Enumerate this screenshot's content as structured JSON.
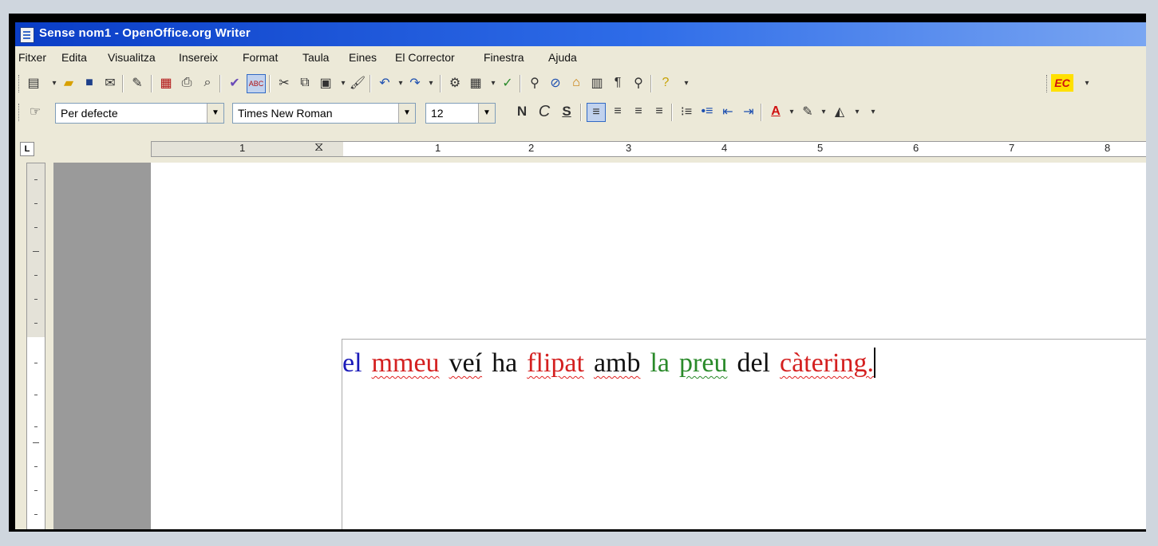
{
  "window": {
    "title": "Sense nom1 - OpenOffice.org Writer"
  },
  "menu": [
    "Fitxer",
    "Edita",
    "Visualitza",
    "Insereix",
    "Format",
    "Taula",
    "Eines",
    "El Corrector",
    "Finestra",
    "Ajuda"
  ],
  "toolbar2": {
    "style": "Per defecte",
    "font": "Times New Roman",
    "size": "12",
    "bold": "N",
    "italic": "C",
    "underline": "S"
  },
  "extension_badge": "EC",
  "ruler_numbers": [
    "1",
    "1",
    "2",
    "3",
    "4",
    "5",
    "6",
    "7",
    "8"
  ],
  "document": {
    "words": [
      {
        "text": "el",
        "color": "#1a1ab8",
        "mark": "none"
      },
      {
        "text": "mmeu",
        "color": "#d42020",
        "mark": "error"
      },
      {
        "text": "veí",
        "color": "#111111",
        "mark": "error"
      },
      {
        "text": "ha",
        "color": "#111111",
        "mark": "none"
      },
      {
        "text": "flipat",
        "color": "#d42020",
        "mark": "error"
      },
      {
        "text": "amb",
        "color": "#111111",
        "mark": "error"
      },
      {
        "text": "la",
        "color": "#2a8a2a",
        "mark": "none"
      },
      {
        "text": "preu",
        "color": "#2a8a2a",
        "mark": "grammar"
      },
      {
        "text": "del",
        "color": "#111111",
        "mark": "none"
      },
      {
        "text": "càtering.",
        "color": "#d42020",
        "mark": "error"
      }
    ]
  }
}
